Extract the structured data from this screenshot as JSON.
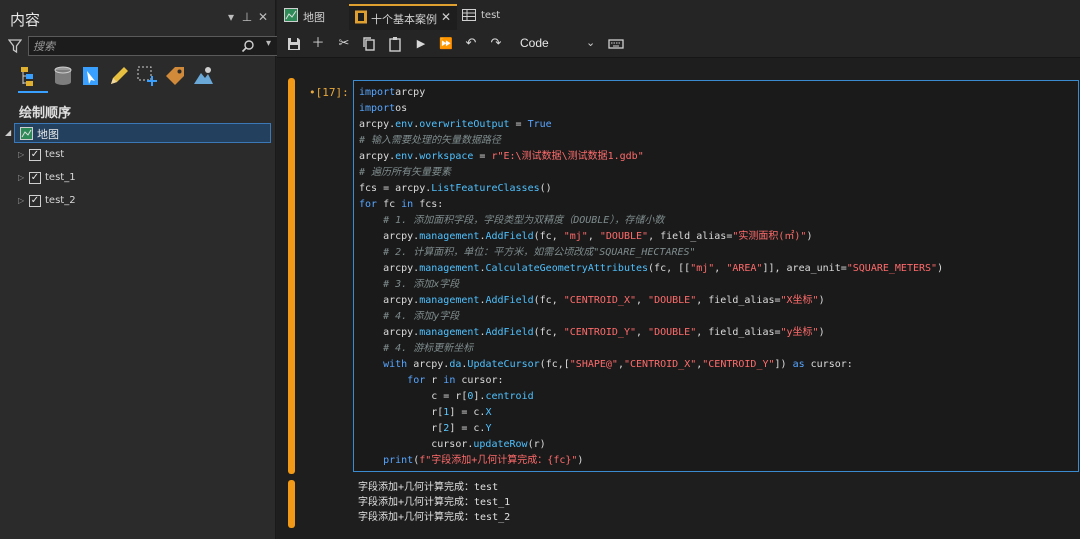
{
  "contents_pane": {
    "title": "内容",
    "controls": [
      "▾",
      "⊥",
      "✕"
    ],
    "search": {
      "placeholder": "搜索"
    },
    "section_title": "绘制顺序",
    "map": "地图",
    "layers": [
      "test",
      "test_1",
      "test_2"
    ]
  },
  "tabs": [
    {
      "label": "地图"
    },
    {
      "label": "十个基本案例",
      "active": true
    },
    {
      "label": "test"
    }
  ],
  "toolbar": {
    "cell_type": "Code"
  },
  "cell": {
    "prompt": "•[17]:",
    "code_lines": [
      [
        [
          "k",
          "import"
        ],
        [
          "",
          "arcpy"
        ]
      ],
      [
        [
          "k",
          "import"
        ],
        [
          "",
          "os"
        ]
      ],
      [
        [
          "",
          "arcpy."
        ],
        [
          "f",
          "env"
        ],
        [
          "",
          "."
        ],
        [
          "f",
          "overwriteOutput"
        ],
        [
          "",
          " = "
        ],
        [
          "k",
          "True"
        ]
      ],
      [
        [
          "c",
          "# 输入需要处理的矢量数据路径"
        ]
      ],
      [
        [
          "",
          "arcpy."
        ],
        [
          "f",
          "env"
        ],
        [
          "",
          "."
        ],
        [
          "f",
          "workspace"
        ],
        [
          "",
          " = "
        ],
        [
          "s",
          "r\"E:\\测试数据\\测试数据1.gdb\""
        ]
      ],
      [
        [
          "c",
          "# 遍历所有矢量要素"
        ]
      ],
      [
        [
          "",
          "fcs = arcpy."
        ],
        [
          "f",
          "ListFeatureClasses"
        ],
        [
          "",
          "()"
        ]
      ],
      [
        [
          "k",
          "for"
        ],
        [
          "",
          " fc "
        ],
        [
          "k",
          "in"
        ],
        [
          "",
          " fcs:"
        ]
      ],
      [
        [
          "",
          "    "
        ],
        [
          "c",
          "# 1. 添加面积字段，字段类型为双精度（DOUBLE），存储小数"
        ]
      ],
      [
        [
          "",
          "    arcpy."
        ],
        [
          "f",
          "management"
        ],
        [
          "",
          "."
        ],
        [
          "f",
          "AddField"
        ],
        [
          "",
          "(fc, "
        ],
        [
          "s",
          "\"mj\""
        ],
        [
          "",
          ", "
        ],
        [
          "s",
          "\"DOUBLE\""
        ],
        [
          "",
          ", field_alias="
        ],
        [
          "s",
          "\"实测面积(㎡)\""
        ],
        [
          "",
          ")"
        ]
      ],
      [
        [
          "",
          "    "
        ],
        [
          "c",
          "# 2. 计算面积，单位：平方米，如需公顷改成\"SQUARE_HECTARES\""
        ]
      ],
      [
        [
          "",
          "    arcpy."
        ],
        [
          "f",
          "management"
        ],
        [
          "",
          "."
        ],
        [
          "f",
          "CalculateGeometryAttributes"
        ],
        [
          "",
          "(fc, [["
        ],
        [
          "s",
          "\"mj\""
        ],
        [
          "",
          ", "
        ],
        [
          "s",
          "\"AREA\""
        ],
        [
          "",
          "]], area_unit="
        ],
        [
          "s",
          "\"SQUARE_METERS\""
        ],
        [
          "",
          ")"
        ]
      ],
      [
        [
          "",
          "    "
        ],
        [
          "c",
          "# 3. 添加x字段"
        ]
      ],
      [
        [
          "",
          "    arcpy."
        ],
        [
          "f",
          "management"
        ],
        [
          "",
          "."
        ],
        [
          "f",
          "AddField"
        ],
        [
          "",
          "(fc, "
        ],
        [
          "s",
          "\"CENTROID_X\""
        ],
        [
          "",
          ", "
        ],
        [
          "s",
          "\"DOUBLE\""
        ],
        [
          "",
          ", field_alias="
        ],
        [
          "s",
          "\"X坐标\""
        ],
        [
          "",
          ")"
        ]
      ],
      [
        [
          "",
          "    "
        ],
        [
          "c",
          "# 4. 添加y字段"
        ]
      ],
      [
        [
          "",
          "    arcpy."
        ],
        [
          "f",
          "management"
        ],
        [
          "",
          "."
        ],
        [
          "f",
          "AddField"
        ],
        [
          "",
          "(fc, "
        ],
        [
          "s",
          "\"CENTROID_Y\""
        ],
        [
          "",
          ", "
        ],
        [
          "s",
          "\"DOUBLE\""
        ],
        [
          "",
          ", field_alias="
        ],
        [
          "s",
          "\"y坐标\""
        ],
        [
          "",
          ")"
        ]
      ],
      [
        [
          "",
          "    "
        ],
        [
          "c",
          "# 4. 游标更新坐标"
        ]
      ],
      [
        [
          "",
          "    "
        ],
        [
          "k",
          "with"
        ],
        [
          "",
          " arcpy."
        ],
        [
          "f",
          "da"
        ],
        [
          "",
          "."
        ],
        [
          "f",
          "UpdateCursor"
        ],
        [
          "",
          "(fc,["
        ],
        [
          "s",
          "\"SHAPE@\""
        ],
        [
          "",
          ","
        ],
        [
          "s",
          "\"CENTROID_X\""
        ],
        [
          "",
          ","
        ],
        [
          "s",
          "\"CENTROID_Y\""
        ],
        [
          "",
          "]) "
        ],
        [
          "k",
          "as"
        ],
        [
          "",
          " cursor:"
        ]
      ],
      [
        [
          "",
          "        "
        ],
        [
          "k",
          "for"
        ],
        [
          "",
          " r "
        ],
        [
          "k",
          "in"
        ],
        [
          "",
          " cursor:"
        ]
      ],
      [
        [
          "",
          "            c = r["
        ],
        [
          "n",
          "0"
        ],
        [
          "",
          "]."
        ],
        [
          "f",
          "centroid"
        ]
      ],
      [
        [
          "",
          "            r["
        ],
        [
          "n",
          "1"
        ],
        [
          "",
          "] = c."
        ],
        [
          "f",
          "X"
        ]
      ],
      [
        [
          "",
          "            r["
        ],
        [
          "n",
          "2"
        ],
        [
          "",
          "] = c."
        ],
        [
          "f",
          "Y"
        ]
      ],
      [
        [
          "",
          "            cursor."
        ],
        [
          "f",
          "updateRow"
        ],
        [
          "",
          "(r)"
        ]
      ],
      [
        [
          "",
          "    "
        ],
        [
          "k",
          "print"
        ],
        [
          "",
          "("
        ],
        [
          "s",
          "f\"字段添加+几何计算完成：{fc}\""
        ],
        [
          "",
          ")"
        ]
      ]
    ]
  },
  "output_lines": [
    "字段添加+几何计算完成：test",
    "字段添加+几何计算完成：test_1",
    "字段添加+几何计算完成：test_2"
  ]
}
